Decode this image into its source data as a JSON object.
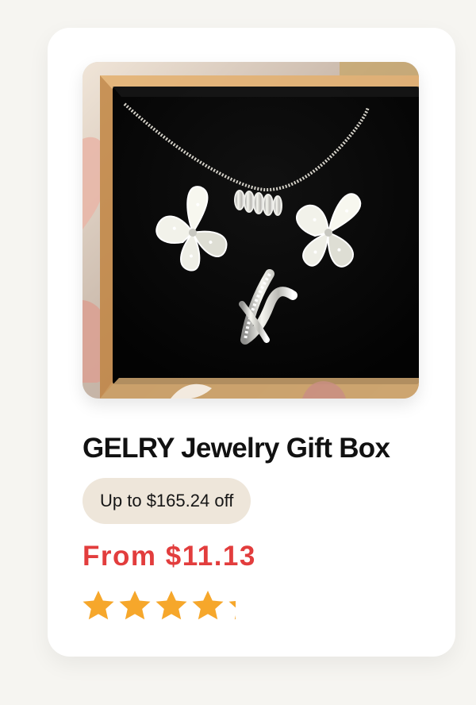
{
  "product": {
    "title": "GELRY Jewelry Gift Box",
    "discount": "Up to $165.24 off",
    "price": "From $11.13",
    "rating": 4.5,
    "max_rating": 5
  },
  "colors": {
    "page_background": "#f6f5f1",
    "card_background": "#ffffff",
    "discount_background": "#eee6da",
    "price": "#e23d3d",
    "star": "#f6a72b"
  },
  "image": {
    "subject": "jewelry gift box with necklace, butterfly earrings and ring"
  }
}
